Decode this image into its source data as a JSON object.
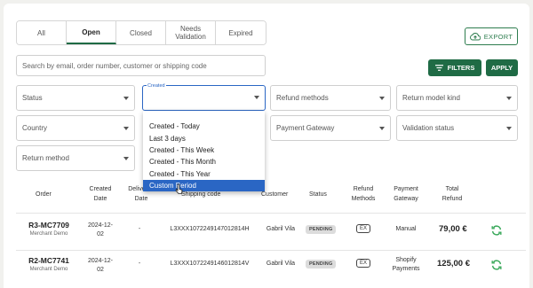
{
  "tabs": [
    {
      "label": "All"
    },
    {
      "label": "Open",
      "active": true
    },
    {
      "label": "Closed"
    },
    {
      "label": "Needs Validation"
    },
    {
      "label": "Expired"
    }
  ],
  "export_label": "EXPORT",
  "search": {
    "placeholder": "Search by email, order number, customer or shipping code"
  },
  "filters_label": "FILTERS",
  "apply_label": "APPLY",
  "filters": {
    "status": "Status",
    "created_label": "Created",
    "created_value": "",
    "refund_methods": "Refund methods",
    "return_model_kind": "Return model kind",
    "country": "Country",
    "payment_gateway": "Payment Gateway",
    "validation_status": "Validation status",
    "return_method": "Return method"
  },
  "created_options": [
    "Created - Today",
    "Last 3 days",
    "Created - This Week",
    "Created - This Month",
    "Created - This Year",
    "Custom Period"
  ],
  "created_options_highlighted": "Custom Period",
  "table": {
    "headers": {
      "order": "Order",
      "created": "Created Date",
      "delivered": "Delivered Date",
      "shipping": "Shipping code",
      "customer": "Customer",
      "status": "Status",
      "refund_methods": "Refund Methods",
      "payment_gateway": "Payment Gateway",
      "total_refund": "Total Refund"
    },
    "rows": [
      {
        "order": "R3-MC7709",
        "merchant": "Merchant Demo",
        "created": "2024-12-02",
        "delivered": "-",
        "shipping": "L3XXX1072249147012814H",
        "customer": "Gabril Vila",
        "status": "PENDING",
        "refund_method": "EX",
        "gateway": "Manual",
        "total": "79,00 €"
      },
      {
        "order": "R2-MC7741",
        "merchant": "Merchant Demo",
        "created": "2024-12-02",
        "delivered": "-",
        "shipping": "L3XXX1072249146012814V",
        "customer": "Gabril Vila",
        "status": "PENDING",
        "refund_method": "EX",
        "gateway": "Shopify Payments",
        "total": "125,00 €"
      }
    ]
  },
  "colors": {
    "accent": "#1f6b45",
    "focus": "#2a66c4"
  },
  "icons": {
    "export": "cloud-upload-icon",
    "filters": "filter-lines-icon",
    "row_action": "refresh-icon"
  }
}
